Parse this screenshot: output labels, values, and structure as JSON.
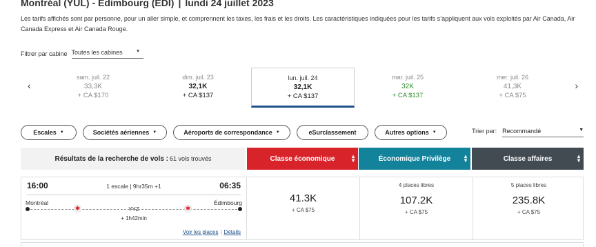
{
  "header": {
    "route": "Montréal (YUL) - Édimbourg (EDI)",
    "separator": "|",
    "date": "lundi 24 juillet 2023",
    "disclaimer": "Les tarifs affichés sont par personne, pour un aller simple, et comprennent les taxes, les frais et les droits. Les caractéristiques indiquées pour les tarifs s’appliquent aux vols exploités par Air Canada, Air Canada Express et Air Canada Rouge."
  },
  "filter": {
    "label": "Filtrer par cabine",
    "value": "Toutes les cabines"
  },
  "dates": [
    {
      "label": "sam. juil. 22",
      "price": "33,3K",
      "cad": "+ CA $170",
      "style": "muted"
    },
    {
      "label": "dim. juil. 23",
      "price": "32,1K",
      "cad": "+ CA $137",
      "style": "dark"
    },
    {
      "label": "lun. juil. 24",
      "price": "32,1K",
      "cad": "+ CA $137",
      "style": "dark",
      "selected": true
    },
    {
      "label": "mar. juil. 25",
      "price": "32K",
      "cad": "+ CA $137",
      "style": "green"
    },
    {
      "label": "mer. juil. 26",
      "price": "41,3K",
      "cad": "+ CA $75",
      "style": "muted"
    }
  ],
  "filters": {
    "stops": "Escales",
    "airlines": "Sociétés aériennes",
    "airports": "Aéroports de correspondance",
    "upgrade": "eSurclassement",
    "other": "Autres options"
  },
  "sort": {
    "label": "Trier par:",
    "value": "Recommandé"
  },
  "results": {
    "label": "Résultats de la recherche de vols :",
    "count": "61 vols trouvés"
  },
  "cabins": {
    "economy": "Classe économique",
    "premium": "Économique Privilège",
    "business": "Classe affaires"
  },
  "flight": {
    "departure": "16:00",
    "arrival": "06:35",
    "stops": "1 escale | 9hr35m +1",
    "from": "Montréal",
    "to": "Édimbourg",
    "via": "YYZ",
    "layover": "+ 1h42min",
    "seats_link": "Voir les places",
    "link_separator": "|",
    "details_link": "Détails",
    "fares": {
      "economy": {
        "seats": "",
        "price": "41.3K",
        "cad": "+ CA $75"
      },
      "premium": {
        "seats": "4 places libres",
        "price": "107.2K",
        "cad": "+ CA $75"
      },
      "business": {
        "seats": "5 places libres",
        "price": "235.8K",
        "cad": "+ CA $75"
      }
    }
  },
  "colors": {
    "economy": "#d8232a",
    "premium": "#13829b",
    "business": "#424a52",
    "selected_underline": "#1f4f8a",
    "green_price": "#2e8b2e"
  }
}
